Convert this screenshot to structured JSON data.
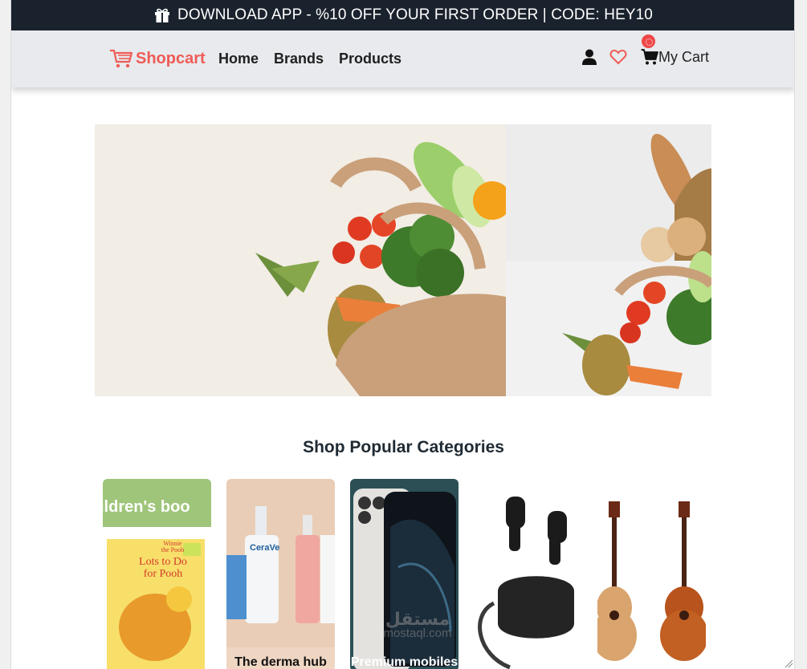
{
  "promo": {
    "text": "DOWNLOAD APP - %10 OFF YOUR FIRST ORDER | CODE: HEY10",
    "icon": "gift-icon"
  },
  "nav": {
    "brand": "Shopcart",
    "links": [
      "Home",
      "Brands",
      "Products"
    ],
    "cart_label": "My Cart",
    "icons": [
      "user-icon",
      "heart-icon",
      "cart-icon"
    ]
  },
  "hero": {
    "slides": 2
  },
  "categories": {
    "title": "Shop Popular Categories",
    "items": [
      {
        "name": "children's books",
        "banner": "ildren's boo",
        "book_title_1": "Winnie the Pooh",
        "book_title_2": "Lots to Do",
        "book_title_3": "for Pooh",
        "label": ""
      },
      {
        "name": "derma",
        "brand_text": "CeraVe",
        "label": "The derma hub"
      },
      {
        "name": "mobiles",
        "label": "Premium mobiles"
      },
      {
        "name": "earbuds",
        "label": ""
      },
      {
        "name": "guitars",
        "label": ""
      }
    ]
  },
  "watermark": {
    "arabic": "مستقل",
    "latin": "mostaql.com"
  },
  "colors": {
    "accent": "#ef5b56",
    "promo_bg": "#1a222d",
    "nav_bg": "#e8eaed",
    "badge": "#ef4747"
  }
}
